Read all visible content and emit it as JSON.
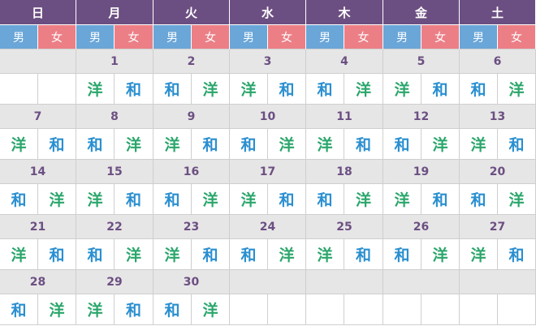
{
  "colors": {
    "header_bg": "#6c4f82",
    "male_bg": "#6aa6d8",
    "female_bg": "#ec7f86",
    "date_bg": "#e6e6e6",
    "wa_color": "#2a8fd0",
    "yo_color": "#2aa66b"
  },
  "days": [
    "日",
    "月",
    "火",
    "水",
    "木",
    "金",
    "土"
  ],
  "genders": {
    "male": "男",
    "female": "女"
  },
  "weeks": [
    {
      "dates": [
        "",
        "1",
        "2",
        "3",
        "4",
        "5",
        "6"
      ],
      "menus": [
        [
          "",
          ""
        ],
        [
          "洋",
          "和"
        ],
        [
          "和",
          "洋"
        ],
        [
          "洋",
          "和"
        ],
        [
          "和",
          "洋"
        ],
        [
          "洋",
          "和"
        ],
        [
          "和",
          "洋"
        ]
      ]
    },
    {
      "dates": [
        "7",
        "8",
        "9",
        "10",
        "11",
        "12",
        "13"
      ],
      "menus": [
        [
          "洋",
          "和"
        ],
        [
          "和",
          "洋"
        ],
        [
          "洋",
          "和"
        ],
        [
          "和",
          "洋"
        ],
        [
          "洋",
          "和"
        ],
        [
          "和",
          "洋"
        ],
        [
          "洋",
          "和"
        ]
      ]
    },
    {
      "dates": [
        "14",
        "15",
        "16",
        "17",
        "18",
        "19",
        "20"
      ],
      "menus": [
        [
          "和",
          "洋"
        ],
        [
          "洋",
          "和"
        ],
        [
          "和",
          "洋"
        ],
        [
          "洋",
          "和"
        ],
        [
          "和",
          "洋"
        ],
        [
          "洋",
          "和"
        ],
        [
          "和",
          "洋"
        ]
      ]
    },
    {
      "dates": [
        "21",
        "22",
        "23",
        "24",
        "25",
        "26",
        "27"
      ],
      "menus": [
        [
          "洋",
          "和"
        ],
        [
          "和",
          "洋"
        ],
        [
          "洋",
          "和"
        ],
        [
          "和",
          "洋"
        ],
        [
          "洋",
          "和"
        ],
        [
          "和",
          "洋"
        ],
        [
          "洋",
          "和"
        ]
      ]
    },
    {
      "dates": [
        "28",
        "29",
        "30",
        "",
        "",
        "",
        ""
      ],
      "menus": [
        [
          "和",
          "洋"
        ],
        [
          "洋",
          "和"
        ],
        [
          "和",
          "洋"
        ],
        [
          "",
          ""
        ],
        [
          "",
          ""
        ],
        [
          "",
          ""
        ],
        [
          "",
          ""
        ]
      ]
    }
  ]
}
